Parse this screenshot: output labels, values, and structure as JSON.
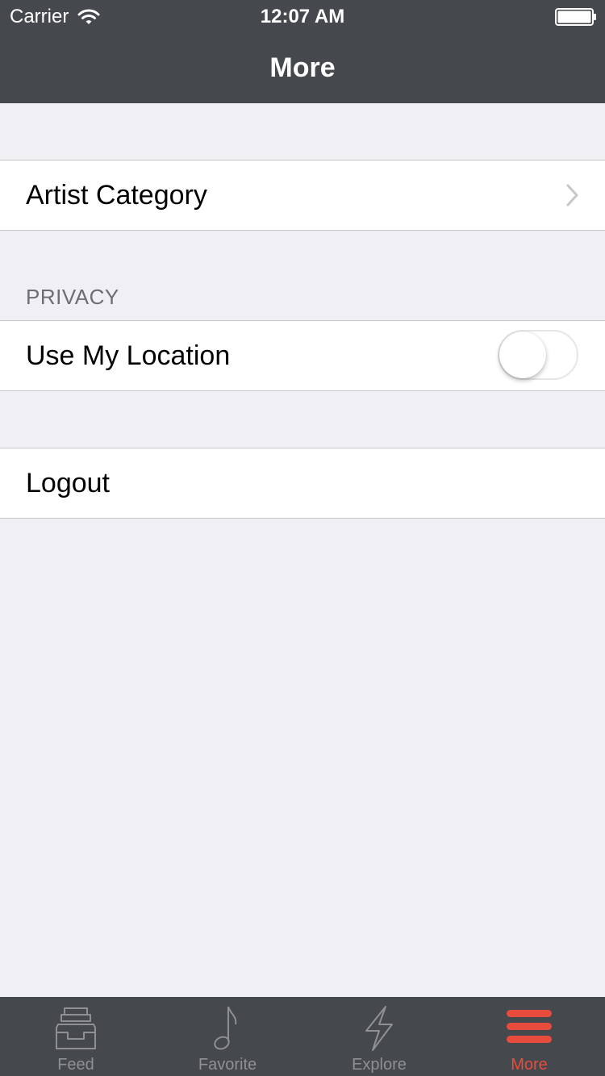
{
  "status_bar": {
    "carrier": "Carrier",
    "time": "12:07 AM"
  },
  "nav": {
    "title": "More"
  },
  "rows": {
    "artist_category": "Artist Category",
    "privacy_header": "PRIVACY",
    "use_my_location": "Use My Location",
    "use_my_location_on": false,
    "logout": "Logout"
  },
  "tabs": [
    {
      "label": "Feed",
      "icon": "inbox-tray-icon",
      "active": false
    },
    {
      "label": "Favorite",
      "icon": "music-note-icon",
      "active": false
    },
    {
      "label": "Explore",
      "icon": "lightning-bolt-icon",
      "active": false
    },
    {
      "label": "More",
      "icon": "hamburger-menu-icon",
      "active": true
    }
  ],
  "colors": {
    "bar": "#45484c",
    "accent": "#e84c3d",
    "background": "#efeff4"
  }
}
